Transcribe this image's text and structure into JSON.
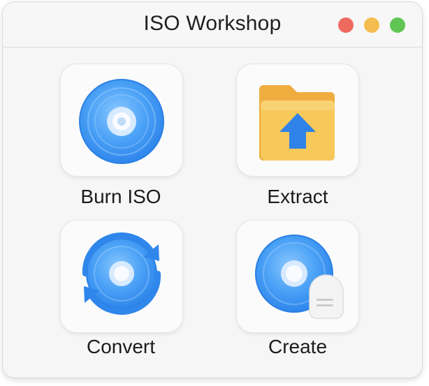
{
  "window": {
    "title": "ISO Workshop",
    "controls": [
      "close",
      "minimize",
      "zoom"
    ]
  },
  "actions": [
    {
      "label": "Burn ISO",
      "icon": "burn-disc-icon"
    },
    {
      "label": "Extract",
      "icon": "folder-upload-icon"
    },
    {
      "label": "Convert",
      "icon": "convert-disc-icon"
    },
    {
      "label": "Create",
      "icon": "create-disc-icon"
    }
  ],
  "colors": {
    "disc_blue": "#3f95f2",
    "folder_yellow": "#f5c45e",
    "close_red": "#ee6a5f",
    "minimize_yellow": "#f5bd4f",
    "zoom_green": "#61c554"
  }
}
